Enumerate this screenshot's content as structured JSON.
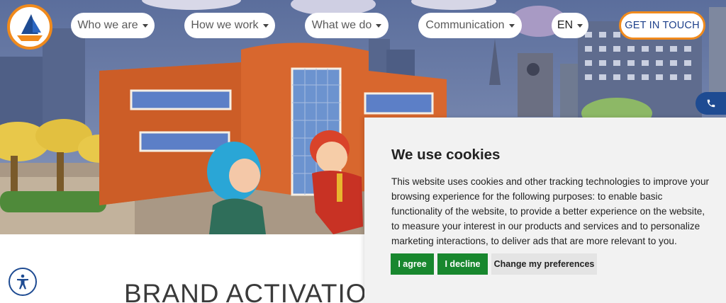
{
  "header": {
    "nav": [
      {
        "label": "Who we are",
        "has_dropdown": true
      },
      {
        "label": "How we work",
        "has_dropdown": true
      },
      {
        "label": "What we do",
        "has_dropdown": true
      },
      {
        "label": "Communication",
        "has_dropdown": true
      }
    ],
    "language": "EN",
    "cta_label": "GET IN TOUCH",
    "logo_icon": "sailboat-logo-icon"
  },
  "hero": {
    "illustration": "cartoon-city-building-characters"
  },
  "floating": {
    "phone_icon": "phone-icon",
    "accessibility_icon": "accessibility-icon"
  },
  "main": {
    "heading": "BRAND ACTIVATION"
  },
  "cookie_banner": {
    "title": "We use cookies",
    "body": "This website uses cookies and other tracking technologies to improve your browsing experience for the following purposes: to enable basic functionality of the website, to provide a better experience on the website, to measure your interest in our products and services and to personalize marketing interactions, to deliver ads that are more relevant to you.",
    "agree_label": "I agree",
    "decline_label": "I decline",
    "preferences_label": "Change my preferences"
  },
  "colors": {
    "accent_orange": "#f08a1c",
    "brand_blue": "#1e4b92",
    "button_green": "#18872e"
  }
}
